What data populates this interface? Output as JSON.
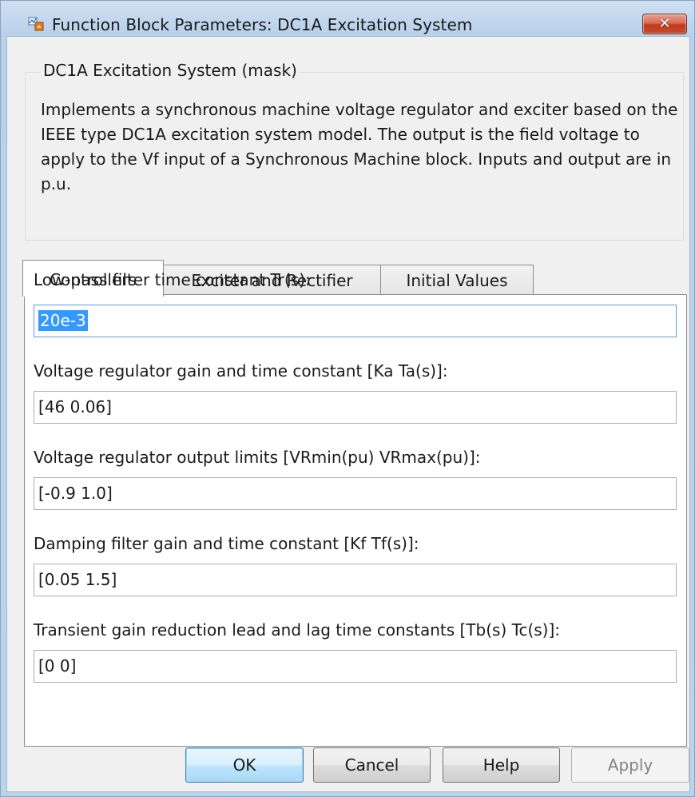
{
  "window": {
    "title": "Function Block Parameters: DC1A Excitation System",
    "close_symbol": "✕"
  },
  "mask": {
    "legend": "DC1A Excitation System (mask)",
    "description": "Implements a synchronous machine voltage regulator and exciter based on the IEEE type DC1A excitation system model. The output is the field voltage to apply to the Vf input of a Synchronous Machine block. Inputs and output are in p.u."
  },
  "tabs": [
    {
      "label": "Controllers",
      "active": true
    },
    {
      "label": "Exciter and Rectifier",
      "active": false
    },
    {
      "label": "Initial Values",
      "active": false
    }
  ],
  "params": [
    {
      "label": "Low-pass filter time constant Tr(s):",
      "value": "20e-3",
      "selected": true
    },
    {
      "label": "Voltage regulator gain and time constant [Ka Ta(s)]:",
      "value": "[46 0.06]"
    },
    {
      "label": "Voltage regulator output limits [VRmin(pu) VRmax(pu)]:",
      "value": "[-0.9 1.0]"
    },
    {
      "label": "Damping filter gain and time constant [Kf Tf(s)]:",
      "value": "[0.05 1.5]"
    },
    {
      "label": "Transient gain reduction lead and lag time constants [Tb(s) Tc(s)]:",
      "value": "[0 0]"
    }
  ],
  "buttons": {
    "ok": "OK",
    "cancel": "Cancel",
    "help": "Help",
    "apply": "Apply"
  },
  "colors": {
    "selection": "#3399ff",
    "default_button": "#bee6fd",
    "close_button": "#c23a1c"
  },
  "icons": {
    "app": "simulink-block-icon",
    "close": "close-icon"
  }
}
